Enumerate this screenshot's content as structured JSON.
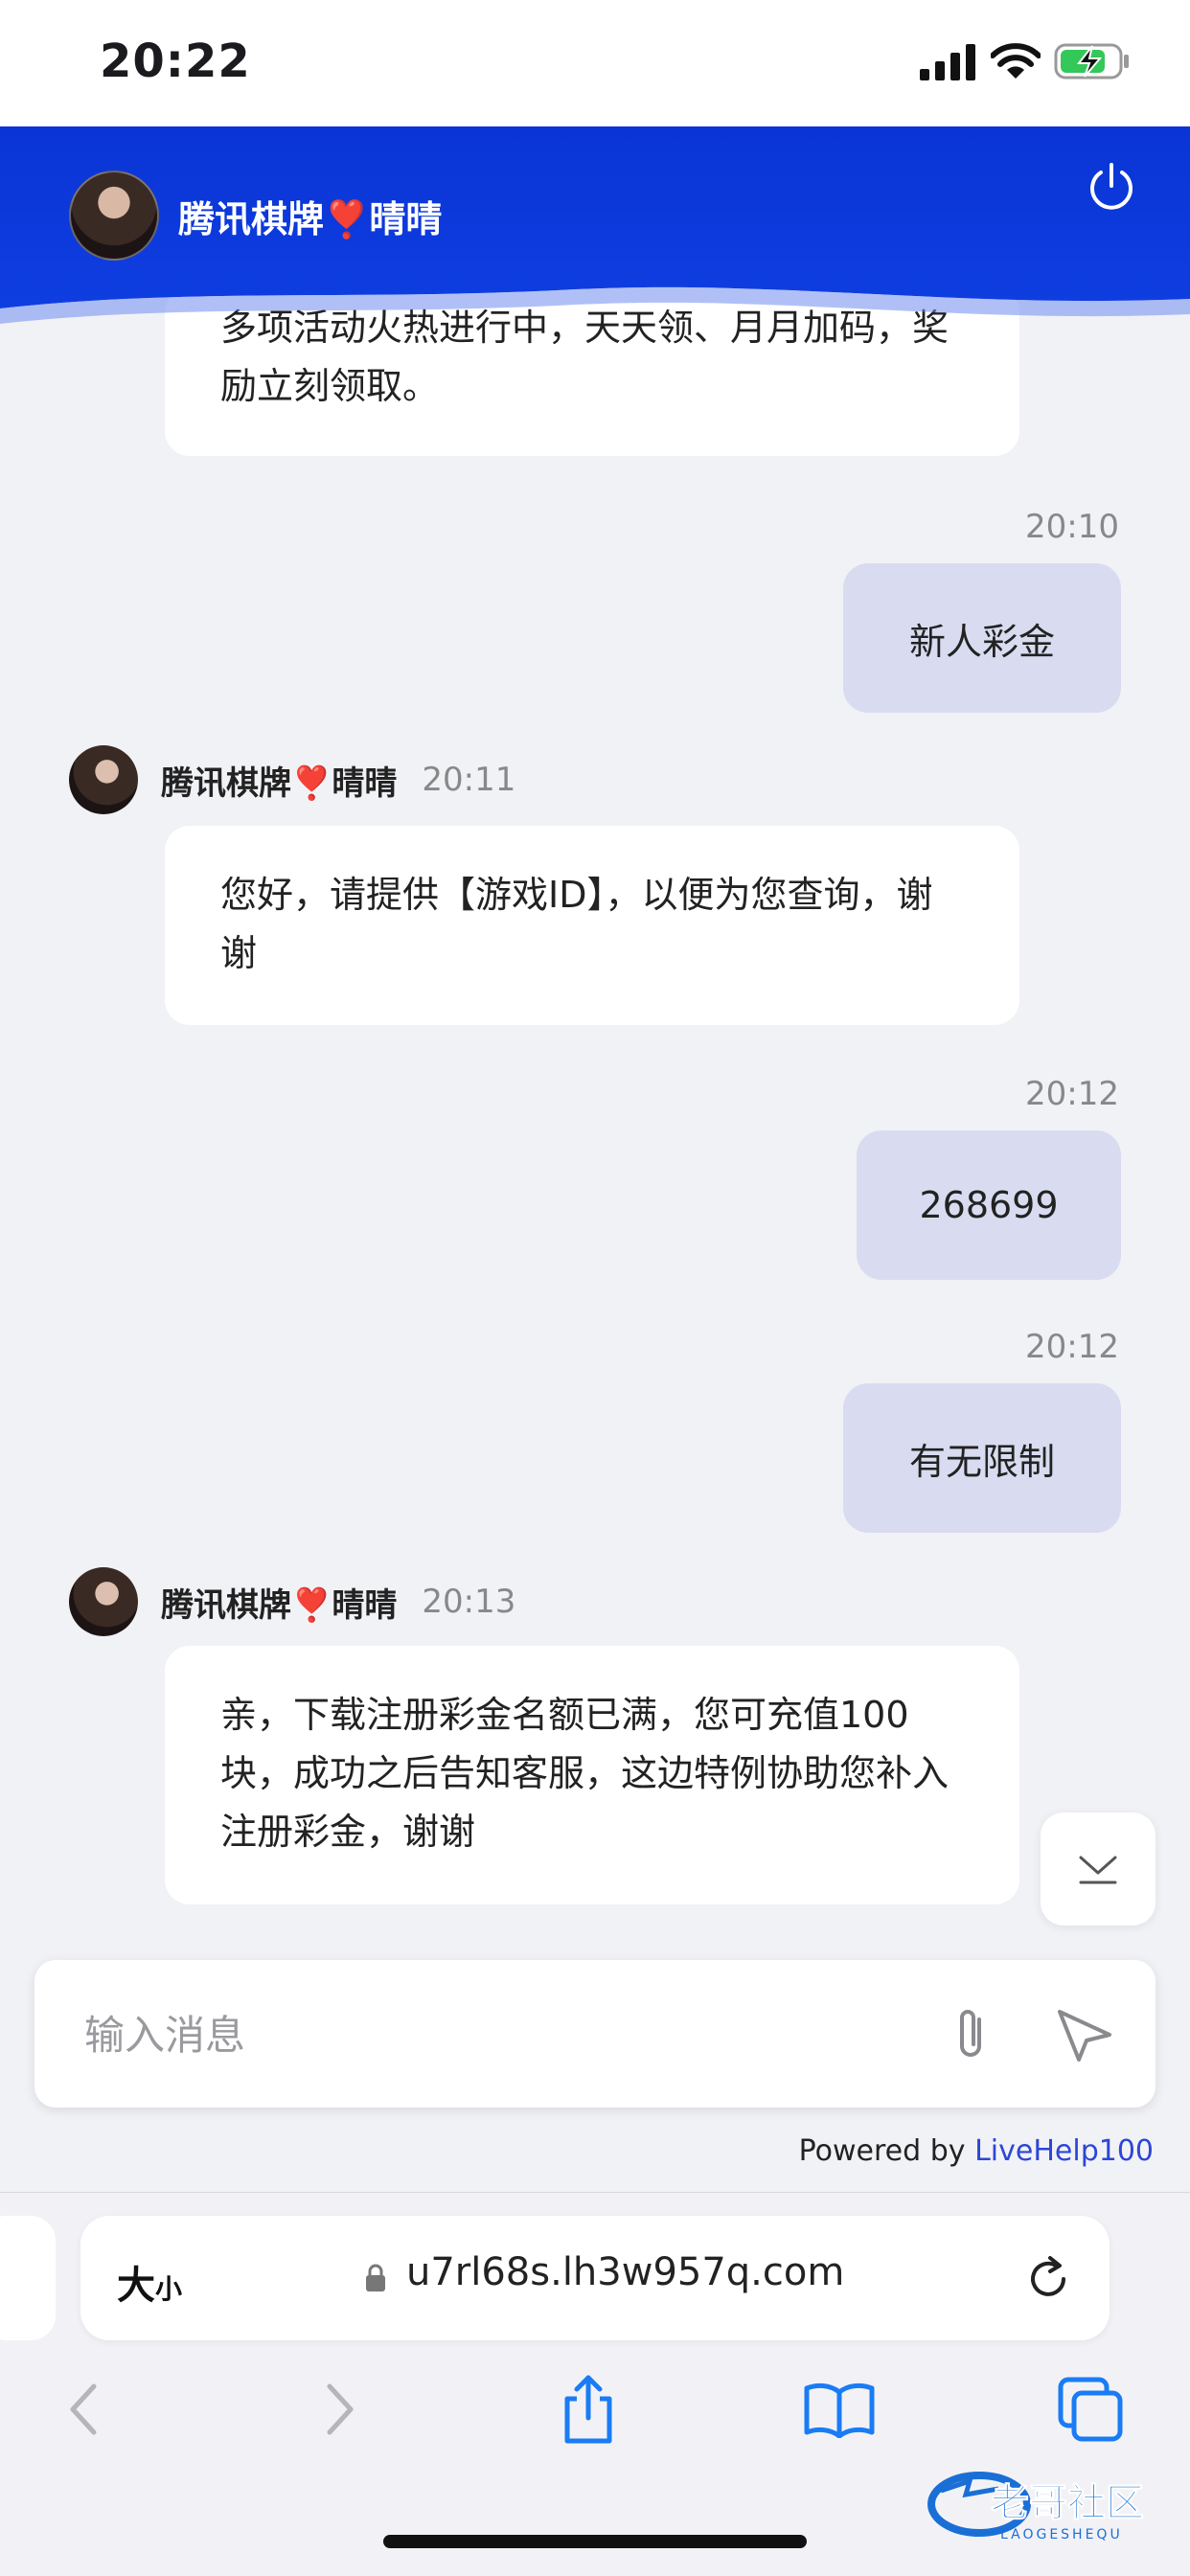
{
  "status_bar": {
    "time": "20:22"
  },
  "header": {
    "title": "腾讯棋牌❣️晴晴",
    "power_icon": "power-icon"
  },
  "messages": [
    {
      "type": "in",
      "text": "多项活动火热进行中，天天领、月月加码，奖励立刻领取。"
    },
    {
      "type": "out",
      "time": "20:10",
      "text": "新人彩金"
    },
    {
      "type": "in",
      "agent": "腾讯棋牌❣️晴晴",
      "time": "20:11",
      "text": "您好，请提供【游戏ID】，以便为您查询，谢谢"
    },
    {
      "type": "out",
      "time": "20:12",
      "text": "268699"
    },
    {
      "type": "out",
      "time": "20:12",
      "text": "有无限制"
    },
    {
      "type": "in",
      "agent": "腾讯棋牌❣️晴晴",
      "time": "20:13",
      "text": "亲，下载注册彩金名额已满，您可充值100块，成功之后告知客服，这边特例协助您补入注册彩金，谢谢"
    }
  ],
  "composer": {
    "placeholder": "输入消息"
  },
  "footer": {
    "powered_by": "Powered by",
    "brand": "LiveHelp100"
  },
  "browser": {
    "text_size": "大",
    "text_size_small": "小",
    "url": "u7rl68s.lh3w957q.com"
  },
  "watermark": {
    "text": "老哥社区",
    "sub": "LAOGESHEQU"
  },
  "colors": {
    "header_blue": "#0b36d8",
    "out_bubble": "#d9dcf0",
    "link_blue": "#2e46d6"
  }
}
